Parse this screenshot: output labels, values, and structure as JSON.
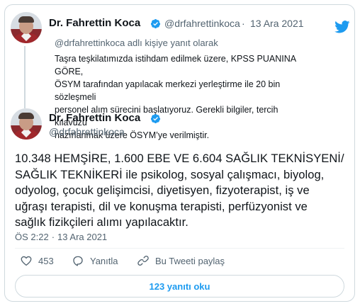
{
  "reply_tweet": {
    "author_name": "Dr. Fahrettin Koca",
    "handle": "@drfahrettinkoca",
    "date": "13 Ara 2021",
    "reply_to": "@drfahrettinkoca adlı kişiye yanıt olarak",
    "text_lines": [
      "Taşra teşkilatımızda istihdam edilmek üzere, KPSS PUANINA GÖRE,",
      "ÖSYM tarafından yapılacak merkezi yerleştirme ile 20 bin sözleşmeli",
      "personel alım sürecini başlatıyoruz. Gerekli bilgiler, tercih kılavuzu",
      "hazırlanmak üzere ÖSYM’ye verilmiştir."
    ]
  },
  "main_tweet": {
    "author_name": "Dr. Fahrettin Koca",
    "handle": "@drfahrettinkoca",
    "text_lines": [
      "10.348 HEMŞİRE, 1.600 EBE VE 6.604 SAĞLIK TEKNİSYENİ/",
      "SAĞLIK TEKNİKERİ ile psikolog, sosyal çalışmacı, biyolog,",
      "odyolog, çocuk gelişimcisi, diyetisyen, fizyoterapist, iş ve",
      "uğraşı terapisti, dil ve konuşma terapisti, perfüzyonist ve",
      "sağlık fizikçileri alımı yapılacaktır."
    ],
    "time": "ÖS 2:22",
    "date": "13 Ara 2021"
  },
  "actions": {
    "like_count": "453",
    "reply_label": "Yanıtla",
    "share_label": "Bu Tweeti paylaş"
  },
  "read_replies_label": "123 yanıtı oku",
  "icons": {
    "brand": "twitter-bird-icon",
    "verified": "verified-badge-icon",
    "like": "heart-icon",
    "reply": "comment-icon",
    "share": "share-icon"
  },
  "colors": {
    "accent": "#1d9bf0",
    "text": "#0f1419",
    "muted": "#536471",
    "border": "#cfd9de"
  }
}
